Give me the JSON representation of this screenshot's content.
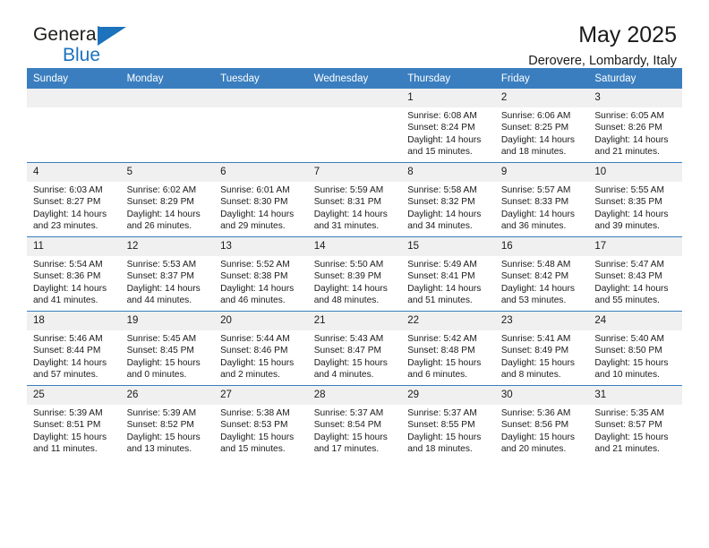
{
  "brand": {
    "name_top": "General",
    "name_bottom": "Blue",
    "accent_color": "#1c72bc"
  },
  "header": {
    "title": "May 2025",
    "location": "Derovere, Lombardy, Italy"
  },
  "theme": {
    "header_row_color": "#3a7ebf",
    "day_number_bg": "#f0f0f0",
    "text_color": "#1a1a1a"
  },
  "weekdays": [
    "Sunday",
    "Monday",
    "Tuesday",
    "Wednesday",
    "Thursday",
    "Friday",
    "Saturday"
  ],
  "labels": {
    "sunrise_prefix": "Sunrise:",
    "sunset_prefix": "Sunset:",
    "daylight_prefix": "Daylight:"
  },
  "weeks": [
    [
      {
        "day": "",
        "empty": true
      },
      {
        "day": "",
        "empty": true
      },
      {
        "day": "",
        "empty": true
      },
      {
        "day": "",
        "empty": true
      },
      {
        "day": "1",
        "sunrise": "Sunrise: 6:08 AM",
        "sunset": "Sunset: 8:24 PM",
        "daylight1": "Daylight: 14 hours",
        "daylight2": "and 15 minutes."
      },
      {
        "day": "2",
        "sunrise": "Sunrise: 6:06 AM",
        "sunset": "Sunset: 8:25 PM",
        "daylight1": "Daylight: 14 hours",
        "daylight2": "and 18 minutes."
      },
      {
        "day": "3",
        "sunrise": "Sunrise: 6:05 AM",
        "sunset": "Sunset: 8:26 PM",
        "daylight1": "Daylight: 14 hours",
        "daylight2": "and 21 minutes."
      }
    ],
    [
      {
        "day": "4",
        "sunrise": "Sunrise: 6:03 AM",
        "sunset": "Sunset: 8:27 PM",
        "daylight1": "Daylight: 14 hours",
        "daylight2": "and 23 minutes."
      },
      {
        "day": "5",
        "sunrise": "Sunrise: 6:02 AM",
        "sunset": "Sunset: 8:29 PM",
        "daylight1": "Daylight: 14 hours",
        "daylight2": "and 26 minutes."
      },
      {
        "day": "6",
        "sunrise": "Sunrise: 6:01 AM",
        "sunset": "Sunset: 8:30 PM",
        "daylight1": "Daylight: 14 hours",
        "daylight2": "and 29 minutes."
      },
      {
        "day": "7",
        "sunrise": "Sunrise: 5:59 AM",
        "sunset": "Sunset: 8:31 PM",
        "daylight1": "Daylight: 14 hours",
        "daylight2": "and 31 minutes."
      },
      {
        "day": "8",
        "sunrise": "Sunrise: 5:58 AM",
        "sunset": "Sunset: 8:32 PM",
        "daylight1": "Daylight: 14 hours",
        "daylight2": "and 34 minutes."
      },
      {
        "day": "9",
        "sunrise": "Sunrise: 5:57 AM",
        "sunset": "Sunset: 8:33 PM",
        "daylight1": "Daylight: 14 hours",
        "daylight2": "and 36 minutes."
      },
      {
        "day": "10",
        "sunrise": "Sunrise: 5:55 AM",
        "sunset": "Sunset: 8:35 PM",
        "daylight1": "Daylight: 14 hours",
        "daylight2": "and 39 minutes."
      }
    ],
    [
      {
        "day": "11",
        "sunrise": "Sunrise: 5:54 AM",
        "sunset": "Sunset: 8:36 PM",
        "daylight1": "Daylight: 14 hours",
        "daylight2": "and 41 minutes."
      },
      {
        "day": "12",
        "sunrise": "Sunrise: 5:53 AM",
        "sunset": "Sunset: 8:37 PM",
        "daylight1": "Daylight: 14 hours",
        "daylight2": "and 44 minutes."
      },
      {
        "day": "13",
        "sunrise": "Sunrise: 5:52 AM",
        "sunset": "Sunset: 8:38 PM",
        "daylight1": "Daylight: 14 hours",
        "daylight2": "and 46 minutes."
      },
      {
        "day": "14",
        "sunrise": "Sunrise: 5:50 AM",
        "sunset": "Sunset: 8:39 PM",
        "daylight1": "Daylight: 14 hours",
        "daylight2": "and 48 minutes."
      },
      {
        "day": "15",
        "sunrise": "Sunrise: 5:49 AM",
        "sunset": "Sunset: 8:41 PM",
        "daylight1": "Daylight: 14 hours",
        "daylight2": "and 51 minutes."
      },
      {
        "day": "16",
        "sunrise": "Sunrise: 5:48 AM",
        "sunset": "Sunset: 8:42 PM",
        "daylight1": "Daylight: 14 hours",
        "daylight2": "and 53 minutes."
      },
      {
        "day": "17",
        "sunrise": "Sunrise: 5:47 AM",
        "sunset": "Sunset: 8:43 PM",
        "daylight1": "Daylight: 14 hours",
        "daylight2": "and 55 minutes."
      }
    ],
    [
      {
        "day": "18",
        "sunrise": "Sunrise: 5:46 AM",
        "sunset": "Sunset: 8:44 PM",
        "daylight1": "Daylight: 14 hours",
        "daylight2": "and 57 minutes."
      },
      {
        "day": "19",
        "sunrise": "Sunrise: 5:45 AM",
        "sunset": "Sunset: 8:45 PM",
        "daylight1": "Daylight: 15 hours",
        "daylight2": "and 0 minutes."
      },
      {
        "day": "20",
        "sunrise": "Sunrise: 5:44 AM",
        "sunset": "Sunset: 8:46 PM",
        "daylight1": "Daylight: 15 hours",
        "daylight2": "and 2 minutes."
      },
      {
        "day": "21",
        "sunrise": "Sunrise: 5:43 AM",
        "sunset": "Sunset: 8:47 PM",
        "daylight1": "Daylight: 15 hours",
        "daylight2": "and 4 minutes."
      },
      {
        "day": "22",
        "sunrise": "Sunrise: 5:42 AM",
        "sunset": "Sunset: 8:48 PM",
        "daylight1": "Daylight: 15 hours",
        "daylight2": "and 6 minutes."
      },
      {
        "day": "23",
        "sunrise": "Sunrise: 5:41 AM",
        "sunset": "Sunset: 8:49 PM",
        "daylight1": "Daylight: 15 hours",
        "daylight2": "and 8 minutes."
      },
      {
        "day": "24",
        "sunrise": "Sunrise: 5:40 AM",
        "sunset": "Sunset: 8:50 PM",
        "daylight1": "Daylight: 15 hours",
        "daylight2": "and 10 minutes."
      }
    ],
    [
      {
        "day": "25",
        "sunrise": "Sunrise: 5:39 AM",
        "sunset": "Sunset: 8:51 PM",
        "daylight1": "Daylight: 15 hours",
        "daylight2": "and 11 minutes."
      },
      {
        "day": "26",
        "sunrise": "Sunrise: 5:39 AM",
        "sunset": "Sunset: 8:52 PM",
        "daylight1": "Daylight: 15 hours",
        "daylight2": "and 13 minutes."
      },
      {
        "day": "27",
        "sunrise": "Sunrise: 5:38 AM",
        "sunset": "Sunset: 8:53 PM",
        "daylight1": "Daylight: 15 hours",
        "daylight2": "and 15 minutes."
      },
      {
        "day": "28",
        "sunrise": "Sunrise: 5:37 AM",
        "sunset": "Sunset: 8:54 PM",
        "daylight1": "Daylight: 15 hours",
        "daylight2": "and 17 minutes."
      },
      {
        "day": "29",
        "sunrise": "Sunrise: 5:37 AM",
        "sunset": "Sunset: 8:55 PM",
        "daylight1": "Daylight: 15 hours",
        "daylight2": "and 18 minutes."
      },
      {
        "day": "30",
        "sunrise": "Sunrise: 5:36 AM",
        "sunset": "Sunset: 8:56 PM",
        "daylight1": "Daylight: 15 hours",
        "daylight2": "and 20 minutes."
      },
      {
        "day": "31",
        "sunrise": "Sunrise: 5:35 AM",
        "sunset": "Sunset: 8:57 PM",
        "daylight1": "Daylight: 15 hours",
        "daylight2": "and 21 minutes."
      }
    ]
  ]
}
